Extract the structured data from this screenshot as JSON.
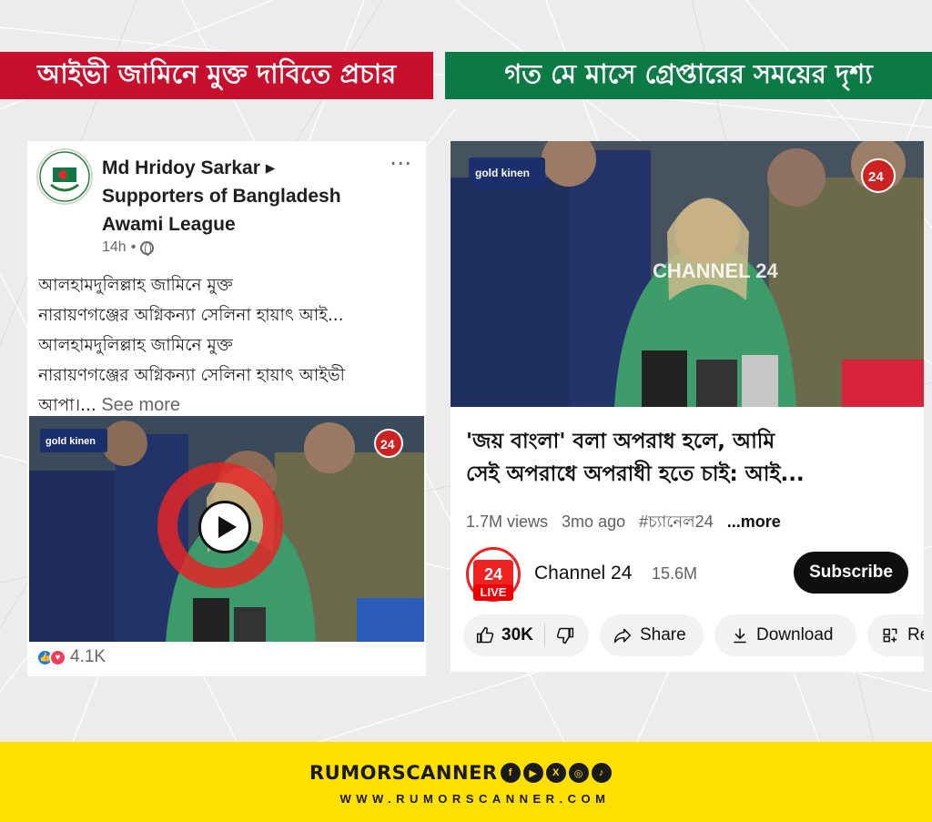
{
  "banners": {
    "left": "আইভী জামিনে মুক্ত দাবিতে প্রচার",
    "right": "গত মে মাসে গ্রেপ্তারের সময়ের দৃশ্য"
  },
  "facebook_post": {
    "author_line1": "Md Hridoy Sarkar ▸",
    "author_line2": "Supporters of Bangladesh",
    "author_line3": "Awami League",
    "more_icon": "⋯",
    "time": "14h",
    "visibility_icon": "globe-icon",
    "text_lines": [
      "আলহামদুলিল্লাহ জামিনে মুক্ত",
      "নারায়ণগঞ্জের অগ্নিকন্যা সেলিনা হায়াৎ আই...",
      "আলহামদুলিল্লাহ জামিনে মুক্ত",
      "নারায়ণগঞ্জের অগ্নিকন্যা সেলিনা হায়াৎ আইভী"
    ],
    "text_last": "আপা।...",
    "see_more": " See more",
    "watermark": "gold kinen",
    "channel_badge": "24",
    "reactions_count": "4.1K"
  },
  "youtube": {
    "watermark": "gold kinen",
    "overlay": "CHANNEL 24",
    "channel_badge": "24",
    "title_line1": "'জয় বাংলা' বলা অপরাধ হলে, আমি",
    "title_line2": "সেই অপরাধে অপরাধী হতে চাই: আই...",
    "views": "1.7M views",
    "age": "3mo ago",
    "hashtag": "#চ্যানেল24",
    "more": "...more",
    "logo_text": "24",
    "live": "LIVE",
    "channel_name": "Channel 24",
    "subscribers": "15.6M",
    "subscribe_label": "Subscribe",
    "likes": "30K",
    "share_label": "Share",
    "download_label": "Download",
    "remix_label": "Re"
  },
  "footer": {
    "brand": "RUMORSCANNER",
    "url": "WWW.RUMORSCANNER.COM",
    "social_icons": [
      "facebook-icon",
      "youtube-icon",
      "x-icon",
      "instagram-icon",
      "tiktok-icon"
    ]
  },
  "colors": {
    "banner_red": "#c8102e",
    "banner_green": "#0b7a45",
    "footer_yellow": "#ffe000"
  }
}
